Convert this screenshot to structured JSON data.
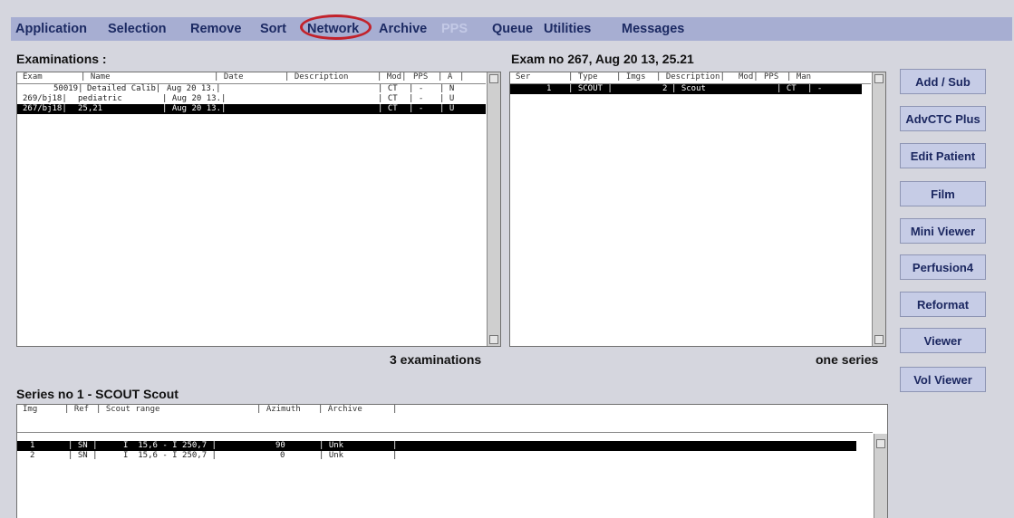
{
  "menu": [
    "Application",
    "Selection",
    "Remove",
    "Sort",
    "Network",
    "Archive",
    "PPS",
    "Queue",
    "Utilities",
    "Messages"
  ],
  "exams": {
    "title": "Examinations :",
    "headers": [
      "Exam",
      "| Name",
      "| Date",
      "| Description",
      "| Mod|",
      "PPS",
      "| A",
      "|"
    ],
    "rows": [
      {
        "exam": "50019|",
        "name": "Detailed Calib|",
        "date": "Aug 20 13.|",
        "desc": "",
        "mod": "| CT",
        "pps": "| -",
        "a": "| N"
      },
      {
        "exam": "269/bj18|",
        "name": "pediatric",
        "date": "| Aug 20 13.|",
        "desc": "",
        "mod": "| CT",
        "pps": "| -",
        "a": "| U"
      },
      {
        "exam": "267/bj18|",
        "name": "25,21",
        "date": "| Aug 20 13.|",
        "desc": "",
        "mod": "| CT",
        "pps": "| -",
        "a": "| U"
      }
    ],
    "count": "3 examinations"
  },
  "series": {
    "title": "Exam no 267,  Aug 20 13, 25.21",
    "headers": [
      "Ser",
      "| Type",
      "| Imgs",
      "| Description|",
      "Mod|",
      "PPS",
      "| Man"
    ],
    "rows": [
      {
        "ser": "1",
        "type": "| SCOUT |",
        "imgs": "2",
        "desc": "| Scout",
        "mod": "| CT",
        "pps": "| -"
      }
    ],
    "count": "one series"
  },
  "images": {
    "title": "Series no 1 - SCOUT  Scout",
    "headers": [
      "Img",
      "| Ref",
      "| Scout range",
      "| Azimuth",
      "| Archive",
      "|"
    ],
    "rows": [
      {
        "img": "1",
        "ref": "| SN |",
        "range": "I  15,6 - I 250,7 |",
        "az": "90",
        "archive": "| Unk",
        "end": "|"
      },
      {
        "img": "2",
        "ref": "| SN |",
        "range": "I  15,6 - I 250,7 |",
        "az": "0",
        "archive": "| Unk",
        "end": "|"
      }
    ]
  },
  "buttons": [
    "Add / Sub",
    "AdvCTC Plus",
    "Edit Patient",
    "Film",
    "Mini Viewer",
    "Perfusion4",
    "Reformat",
    "Viewer",
    "Vol Viewer"
  ]
}
